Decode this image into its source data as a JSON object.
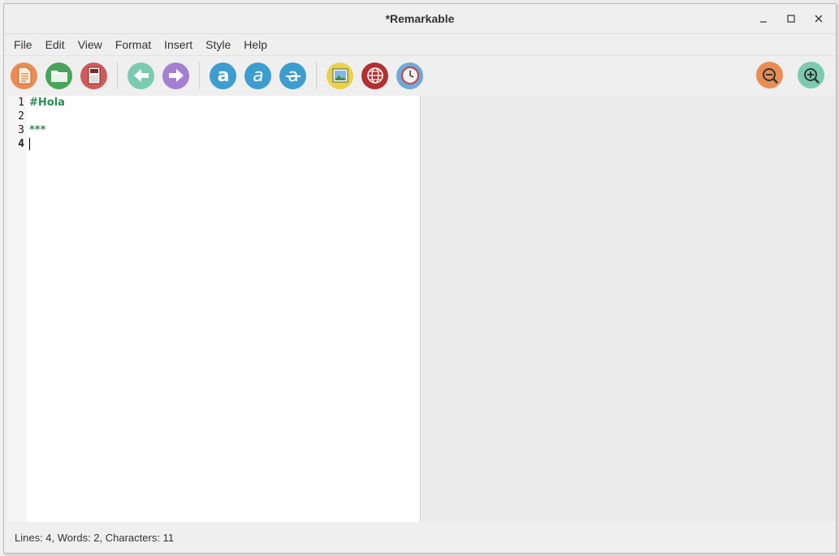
{
  "window": {
    "title": "*Remarkable",
    "controls": [
      "minimize",
      "maximize",
      "close"
    ]
  },
  "menubar": {
    "items": [
      "File",
      "Edit",
      "View",
      "Format",
      "Insert",
      "Style",
      "Help"
    ]
  },
  "toolbar": {
    "groups": [
      [
        {
          "name": "new-document",
          "icon": "new-document-icon",
          "color": "#e98d55"
        },
        {
          "name": "open-folder",
          "icon": "open-folder-icon",
          "color": "#4aa35a"
        },
        {
          "name": "save",
          "icon": "save-icon",
          "color": "#d05a5a"
        }
      ],
      [
        {
          "name": "undo",
          "icon": "undo-arrow-icon",
          "color": "#7bcbb0"
        },
        {
          "name": "redo",
          "icon": "redo-arrow-icon",
          "color": "#a57fd0"
        }
      ],
      [
        {
          "name": "bold",
          "icon": "bold-a-icon",
          "color": "#3d9dd0"
        },
        {
          "name": "italic",
          "icon": "italic-a-icon",
          "color": "#3d9dd0"
        },
        {
          "name": "strikethrough",
          "icon": "strikethrough-a-icon",
          "color": "#3d9dd0"
        }
      ],
      [
        {
          "name": "insert-image",
          "icon": "image-icon",
          "color": "#e8d24a"
        },
        {
          "name": "insert-link",
          "icon": "globe-icon",
          "color": "#b23030"
        },
        {
          "name": "insert-timestamp",
          "icon": "clock-icon",
          "color": "#6fa8d8"
        }
      ]
    ],
    "right": [
      {
        "name": "zoom-out",
        "icon": "zoom-out-icon",
        "color": "#e98d55"
      },
      {
        "name": "zoom-in",
        "icon": "zoom-in-icon",
        "color": "#7bcbb0"
      }
    ]
  },
  "editor": {
    "line_numbers": [
      "1",
      "2",
      "3",
      "4"
    ],
    "current_line": 4,
    "lines": [
      "#Hola",
      "",
      "***",
      ""
    ]
  },
  "statusbar": {
    "text": "Lines: 4, Words: 2, Characters: 11"
  }
}
